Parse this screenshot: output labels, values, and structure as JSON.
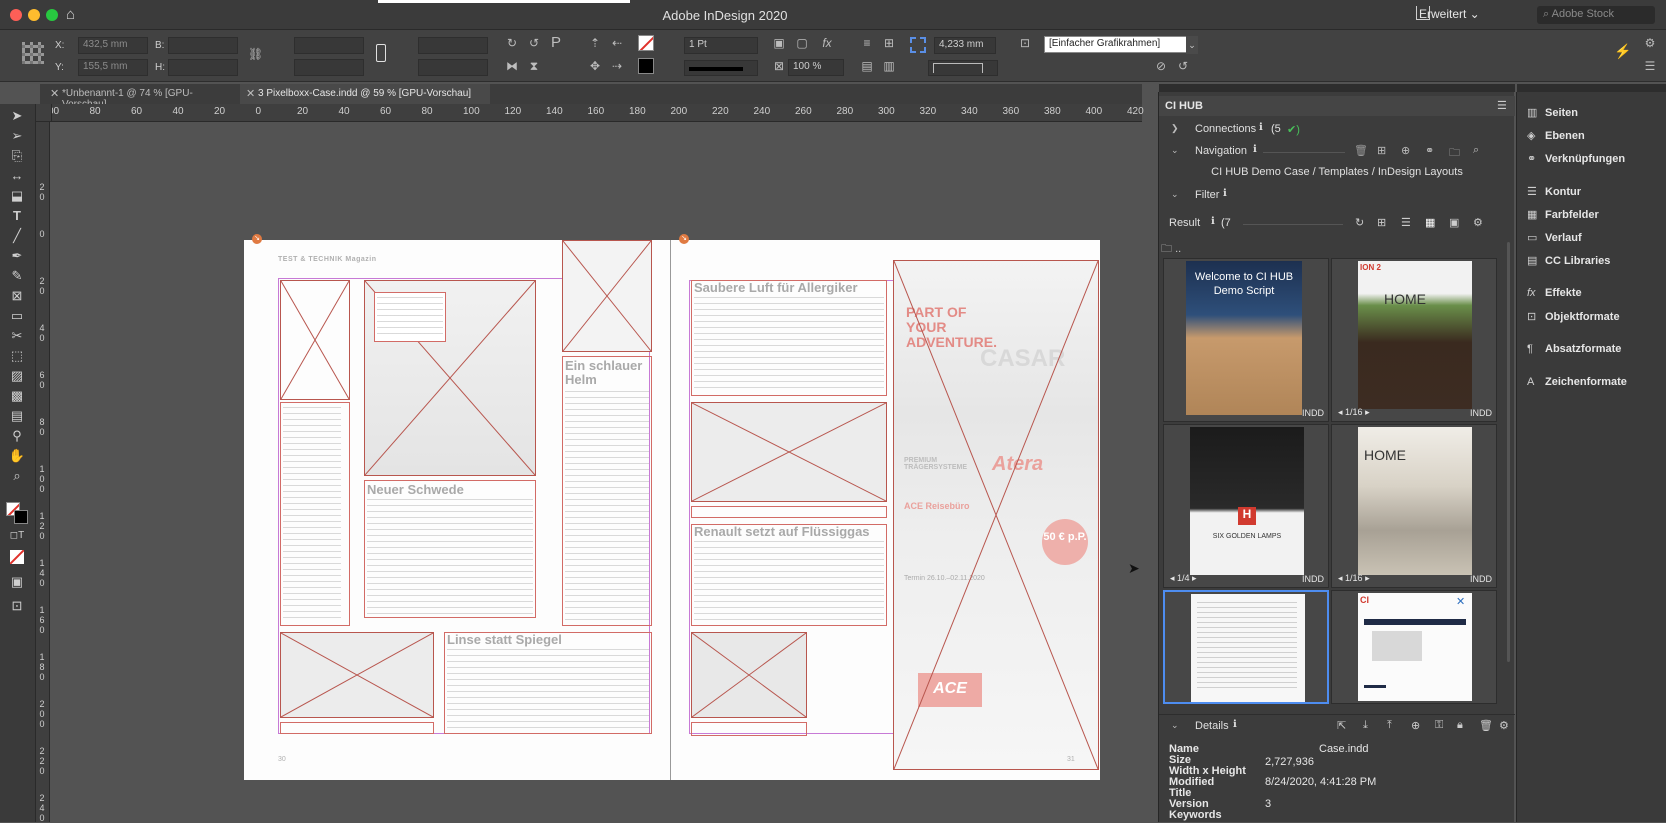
{
  "app": {
    "title": "Adobe InDesign 2020",
    "workspace": "Erweitert",
    "stock_placeholder": "Adobe Stock"
  },
  "control": {
    "x_label": "X:",
    "x_value": "432,5 mm",
    "y_label": "Y:",
    "y_value": "155,5 mm",
    "b_label": "B:",
    "h_label": "H:",
    "stroke_weight": "1 Pt",
    "scale": "100 %",
    "offset": "4,233 mm",
    "object_style": "[Einfacher Grafikrahmen]"
  },
  "tabs": [
    {
      "label": "*Unbenannt-1 @ 74 % [GPU-Vorschau]",
      "active": false
    },
    {
      "label": "3 Pixelboxx-Case.indd @ 59 % [GPU-Vorschau]",
      "active": true
    }
  ],
  "ruler": {
    "h_ticks": [
      "00",
      "80",
      "60",
      "40",
      "20",
      "0",
      "20",
      "40",
      "60",
      "80",
      "100",
      "120",
      "140",
      "160",
      "180",
      "200",
      "220",
      "240",
      "260",
      "280",
      "300",
      "320",
      "340",
      "360",
      "380",
      "400",
      "420"
    ],
    "v_ticks": [
      "2 0",
      "0",
      "2 0",
      "4 0",
      "6 0",
      "8 0",
      "1 0 0",
      "1 2 0",
      "1 4 0",
      "1 6 0",
      "1 8 0",
      "2 0 0",
      "2 2 0",
      "2 4 0"
    ]
  },
  "document": {
    "left_page": {
      "kicker": "TEST & TECHNIK Magazin",
      "headline_1": "Neuer Schwede",
      "headline_2": "Ein schlauer Helm",
      "headline_3": "Linse statt Spiegel",
      "folio": "30"
    },
    "right_page": {
      "headline_1": "Saubere Luft für Allergiker",
      "headline_2": "Renault setzt auf Flüssiggas",
      "ad_title": "PART OF YOUR ADVENTURE.",
      "ad_brand": "CASAR",
      "ad_sub": "PREMIUM TRÄGERSYSTEME",
      "ad_logo": "Atera",
      "ad_dealer": "ACE Reisebüro",
      "ad_price": "50 € p.P.",
      "ad_termin": "Termin 26.10.–02.11.2020",
      "folio": "31"
    }
  },
  "cihub": {
    "panel_title": "CI HUB",
    "connections_label": "Connections",
    "connections_count": "(5",
    "connections_check": "✔)",
    "navigation_label": "Navigation",
    "path": "CI HUB Demo Case / Templates / InDesign Layouts",
    "filter_label": "Filter",
    "result_label": "Result",
    "result_count": "(7",
    "up_folder": "..",
    "thumbs": [
      {
        "title_1": "Welcome to CI HUB",
        "title_2": "Demo Script",
        "badge": "INDD",
        "pages": ""
      },
      {
        "title_1": "HOME",
        "title_2": "ION 2",
        "badge": "INDD",
        "pages": "1/16"
      },
      {
        "title_1": "SIX GOLDEN LAMPS",
        "title_2": "H",
        "badge": "INDD",
        "pages": "1/4"
      },
      {
        "title_1": "HOME",
        "title_2": "",
        "badge": "INDD",
        "pages": "1/16"
      },
      {
        "title_1": "",
        "title_2": "",
        "badge": "",
        "pages": ""
      },
      {
        "title_1": "CI",
        "title_2": "",
        "badge": "",
        "pages": ""
      }
    ],
    "details_label": "Details",
    "details": {
      "name_label": "Name",
      "name_value": "Case.indd",
      "size_label": "Size",
      "size_value": "2,727,936",
      "wh_label": "Width x Height",
      "wh_value": "",
      "modified_label": "Modified",
      "modified_value": "8/24/2020, 4:41:28 PM",
      "title_label": "Title",
      "title_value": "",
      "version_label": "Version",
      "version_value": "3",
      "keywords_label": "Keywords",
      "keywords_value": ""
    }
  },
  "right_panels": [
    "Seiten",
    "Ebenen",
    "Verknüpfungen",
    "Kontur",
    "Farbfelder",
    "Verlauf",
    "CC Libraries",
    "Effekte",
    "Objektformate",
    "Absatzformate",
    "Zeichenformate"
  ],
  "colors": {
    "frame_red": "#b8564e",
    "margin_magenta": "#c77ad6",
    "selection_blue": "#4e8df0",
    "check_green": "#48c15a"
  }
}
